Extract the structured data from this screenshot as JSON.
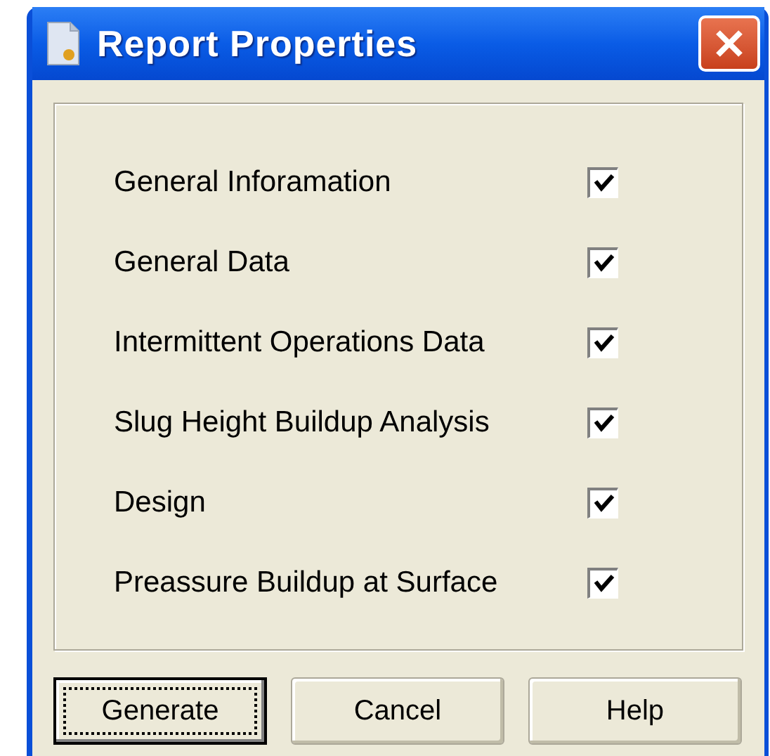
{
  "window": {
    "title": "Report Properties"
  },
  "options": [
    {
      "label": "General Inforamation",
      "checked": true
    },
    {
      "label": "General Data",
      "checked": true
    },
    {
      "label": "Intermittent Operations Data",
      "checked": true
    },
    {
      "label": "Slug Height Buildup Analysis",
      "checked": true
    },
    {
      "label": "Design",
      "checked": true
    },
    {
      "label": "Preassure Buildup at Surface",
      "checked": true
    }
  ],
  "buttons": [
    {
      "label": "Generate",
      "default": true
    },
    {
      "label": "Cancel",
      "default": false
    },
    {
      "label": "Help",
      "default": false
    }
  ]
}
